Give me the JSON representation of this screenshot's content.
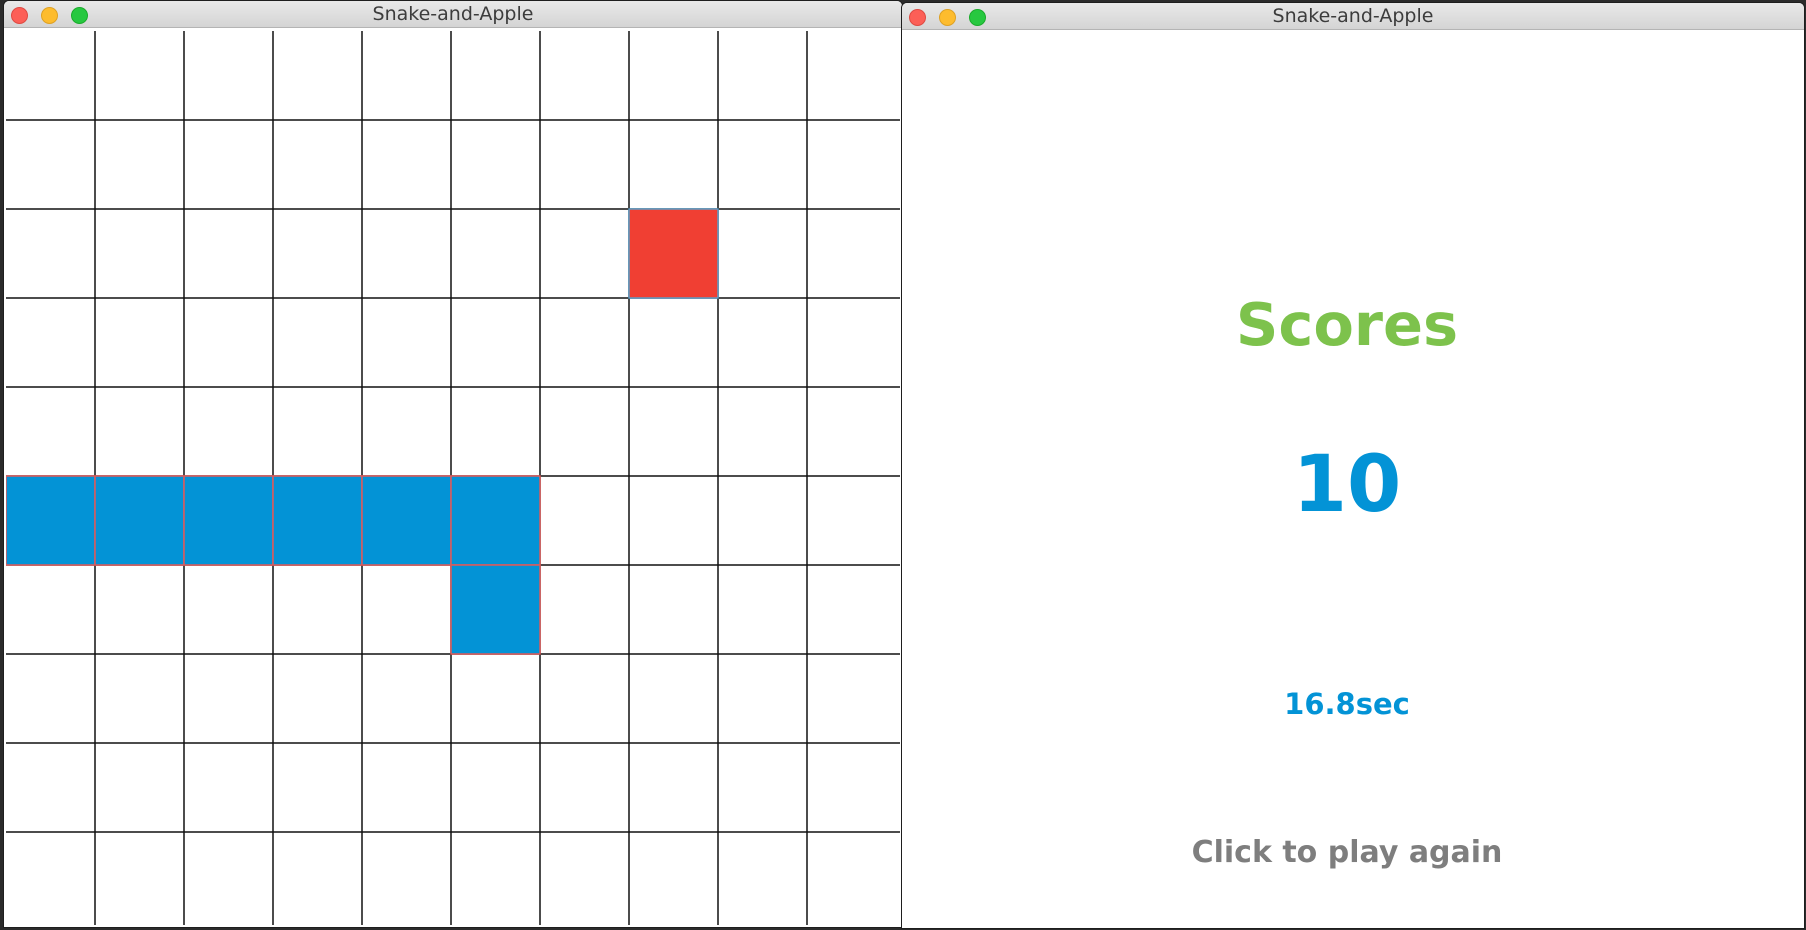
{
  "colors": {
    "snake": "#0393d6",
    "snake_border": "#e05a5a",
    "apple": "#f03f33",
    "apple_border": "#5d9ec8",
    "grid": "#111111",
    "scores_title": "#7dc24c",
    "score_value": "#0393d6",
    "time": "#0393d6",
    "play_again": "#7e7e7e"
  },
  "game_window": {
    "title": "Snake-and-Apple",
    "board": {
      "columns": 10,
      "rows": 10,
      "snake_cells": [
        [
          0,
          5
        ],
        [
          1,
          5
        ],
        [
          2,
          5
        ],
        [
          3,
          5
        ],
        [
          4,
          5
        ],
        [
          5,
          5
        ],
        [
          5,
          6
        ]
      ],
      "apple_cell": [
        7,
        2
      ]
    }
  },
  "score_window": {
    "title": "Snake-and-Apple",
    "scores_label": "Scores",
    "score": "10",
    "time": "16.8sec",
    "play_again_label": "Click to play again"
  }
}
